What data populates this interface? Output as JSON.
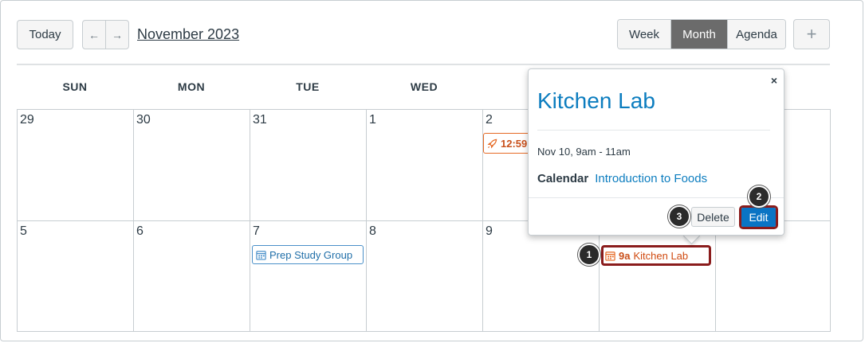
{
  "toolbar": {
    "today_label": "Today",
    "prev_icon": "←",
    "next_icon": "→",
    "month_title": "November 2023",
    "views": [
      "Week",
      "Month",
      "Agenda"
    ],
    "active_view": "Month",
    "add_icon": "+"
  },
  "weekdays": [
    "SUN",
    "MON",
    "TUE",
    "WED"
  ],
  "weeks": [
    [
      "29",
      "30",
      "31",
      "1",
      "2"
    ],
    [
      "5",
      "6",
      "7",
      "8",
      "9"
    ]
  ],
  "events": {
    "prep": {
      "label": "Prep Study Group",
      "color": "#1f6ea8"
    },
    "rocket": {
      "time": "12:59",
      "color": "#c9501b"
    },
    "kitchen": {
      "time": "9a",
      "label": "Kitchen Lab",
      "color": "#c9501b"
    }
  },
  "popover": {
    "title": "Kitchen Lab",
    "close_icon": "×",
    "when": "Nov 10, 9am - 11am",
    "calendar_label": "Calendar",
    "calendar_value": "Introduction to Foods",
    "delete_label": "Delete",
    "edit_label": "Edit"
  },
  "callouts": {
    "one": "1",
    "two": "2",
    "three": "3"
  },
  "colors": {
    "accent": "#0c7dbf",
    "highlight": "#8a1c1c",
    "active_view_bg": "#6b6b6b"
  }
}
